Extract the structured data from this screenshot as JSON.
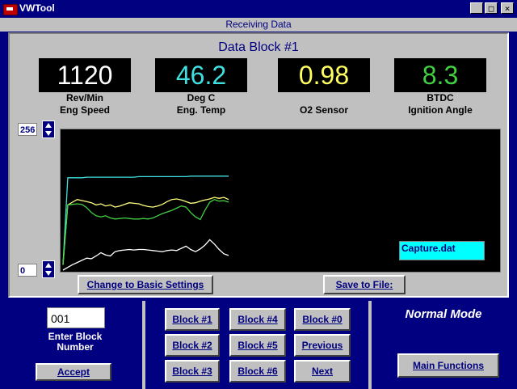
{
  "window": {
    "title": "VWTool",
    "min_glyph": "_",
    "max_glyph": "□",
    "close_glyph": "×"
  },
  "status": "Receiving Data",
  "block_title": "Data Block #1",
  "gauges": [
    {
      "value": "1120",
      "unit": "Rev/Min",
      "label": "Eng Speed",
      "color": "#ffffff"
    },
    {
      "value": "46.2",
      "unit": "Deg C",
      "label": "Eng. Temp",
      "color": "#40e0e0"
    },
    {
      "value": "0.98",
      "unit": "",
      "label": "O2 Sensor",
      "color": "#ffff60"
    },
    {
      "value": "8.3",
      "unit": "BTDC",
      "label": "Ignition Angle",
      "color": "#40d040"
    }
  ],
  "scale": {
    "max": "256",
    "min": "0"
  },
  "buttons": {
    "basic_settings": "Change to Basic Settings",
    "save_to_file": "Save to File:",
    "accept": "Accept",
    "main_functions": "Main Functions"
  },
  "file_name": "Capture.dat",
  "block_entry": {
    "value": "001",
    "label_line1": "Enter Block",
    "label_line2": "Number"
  },
  "block_buttons": [
    "Block #1",
    "Block #4",
    "Block #0",
    "Block #2",
    "Block #5",
    "Previous",
    "Block #3",
    "Block #6",
    "Next"
  ],
  "mode": "Normal Mode",
  "chart_data": {
    "type": "line",
    "ylim": [
      0,
      256
    ],
    "x": [
      0,
      2,
      4,
      6,
      8,
      10,
      12,
      14,
      16,
      18,
      20,
      22,
      24,
      26,
      28,
      30,
      32,
      34,
      36,
      38,
      40,
      42,
      44,
      46,
      48,
      50,
      52,
      54,
      56,
      58,
      60,
      62,
      64,
      66,
      68,
      70
    ],
    "series": [
      {
        "color": "#40e0e0",
        "values": [
          10,
          170,
          170,
          170,
          170,
          171,
          171,
          171,
          171,
          171,
          171,
          171,
          171,
          171,
          171,
          171,
          172,
          172,
          172,
          172,
          172,
          172,
          172,
          172,
          172,
          172,
          172,
          173,
          173,
          173,
          173,
          173,
          173,
          173,
          173,
          173
        ]
      },
      {
        "color": "#ffff80",
        "values": [
          10,
          120,
          125,
          130,
          128,
          126,
          124,
          120,
          122,
          118,
          120,
          116,
          118,
          121,
          124,
          123,
          122,
          119,
          117,
          116,
          118,
          121,
          126,
          130,
          131,
          129,
          126,
          123,
          124,
          127,
          129,
          131,
          134,
          132,
          134,
          130
        ]
      },
      {
        "color": "#40d040",
        "values": [
          10,
          120,
          121,
          122,
          121,
          115,
          106,
          100,
          98,
          100,
          96,
          94,
          95,
          96,
          95,
          94,
          94,
          95,
          94,
          96,
          100,
          104,
          107,
          110,
          114,
          118,
          116,
          106,
          98,
          93,
          110,
          125,
          130,
          127,
          128,
          125
        ]
      },
      {
        "color": "#ffffff",
        "values": [
          0,
          5,
          10,
          14,
          18,
          22,
          21,
          26,
          32,
          28,
          26,
          34,
          36,
          37,
          38,
          37,
          38,
          38,
          37,
          36,
          35,
          34,
          36,
          37,
          36,
          40,
          44,
          38,
          34,
          39,
          46,
          56,
          48,
          38,
          30,
          27
        ]
      }
    ]
  }
}
